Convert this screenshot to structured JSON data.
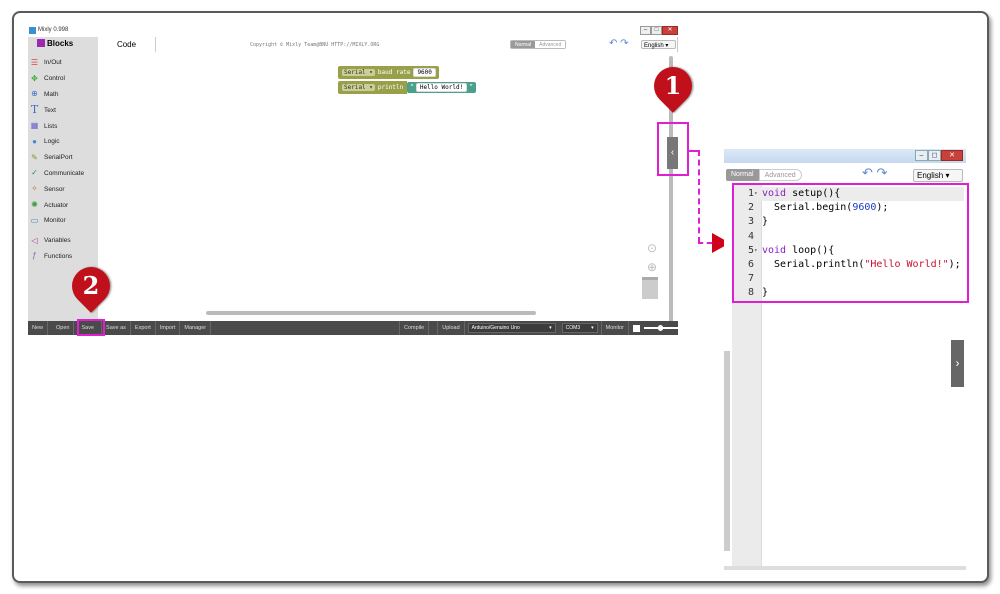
{
  "app": {
    "title": "Mixly 0.998",
    "tabs": {
      "blocks": "Blocks",
      "code": "Code"
    },
    "copyright": "Copyright © Mixly Team@BNU HTTP://MIXLY.ORG",
    "mode": {
      "normal": "Normal",
      "advanced": "Advanced"
    },
    "language": "English",
    "categories": [
      {
        "label": "In/Out",
        "icon": "inout-icon",
        "color": "#d44"
      },
      {
        "label": "Control",
        "icon": "gamepad-icon",
        "color": "#3a3"
      },
      {
        "label": "Math",
        "icon": "math-icon",
        "color": "#3a6fd0"
      },
      {
        "label": "Text",
        "icon": "text-icon",
        "color": "#3a6fd0"
      },
      {
        "label": "Lists",
        "icon": "list-icon",
        "color": "#6a5acd"
      },
      {
        "label": "Logic",
        "icon": "bulb-icon",
        "color": "#3a8fd0"
      },
      {
        "label": "SerialPort",
        "icon": "pen-icon",
        "color": "#7a9a2a"
      },
      {
        "label": "Communicate",
        "icon": "antenna-icon",
        "color": "#2a8a6a"
      },
      {
        "label": "Sensor",
        "icon": "sensor-icon",
        "color": "#b07a3a"
      },
      {
        "label": "Actuator",
        "icon": "actuator-icon",
        "color": "#3a9a3a"
      },
      {
        "label": "Monitor",
        "icon": "monitor-icon",
        "color": "#3a6fd0"
      },
      {
        "label": "Variables",
        "icon": "variables-icon",
        "color": "#b03a8a"
      },
      {
        "label": "Functions",
        "icon": "function-icon",
        "color": "#8a5ab0"
      }
    ],
    "blocks": {
      "serial1": "Serial",
      "baud_label": "baud rate",
      "baud_value": "9600",
      "serial2": "Serial",
      "println": "println",
      "quote": "“",
      "string_value": "Hello World!",
      "quote_end": "”"
    },
    "toolbar": {
      "new": "New",
      "open": "Open",
      "save": "Save",
      "save_as": "Save as",
      "export": "Export",
      "import": "Import",
      "manager": "Manager",
      "compile": "Compile",
      "upload": "Upload",
      "board": "Arduino/Genuino Uno",
      "port": "COM3",
      "monitor": "Monitor"
    }
  },
  "code_panel": {
    "mode": {
      "normal": "Normal",
      "advanced": "Advanced"
    },
    "language": "English",
    "lines": [
      {
        "n": "1",
        "fold": "▾"
      },
      {
        "n": "2",
        "fold": ""
      },
      {
        "n": "3",
        "fold": ""
      },
      {
        "n": "4",
        "fold": ""
      },
      {
        "n": "5",
        "fold": "▾"
      },
      {
        "n": "6",
        "fold": ""
      },
      {
        "n": "7",
        "fold": ""
      },
      {
        "n": "8",
        "fold": ""
      }
    ],
    "code": {
      "l1_kw": "void",
      "l1_rest": " setup(){",
      "l2_pre": "  Serial.begin(",
      "l2_num": "9600",
      "l2_post": ");",
      "l3": "}",
      "l4": "",
      "l5_kw": "void",
      "l5_rest": " loop(){",
      "l6_pre": "  Serial.println(",
      "l6_str": "\"Hello World!\"",
      "l6_post": ");",
      "l7": "",
      "l8": "}"
    }
  },
  "annotations": {
    "marker1": "1",
    "marker2": "2"
  },
  "colors": {
    "highlight": "#e020d0",
    "marker": "#c0101b",
    "keyword": "#8a1fbf",
    "number": "#1640c8",
    "string": "#c8102e"
  }
}
